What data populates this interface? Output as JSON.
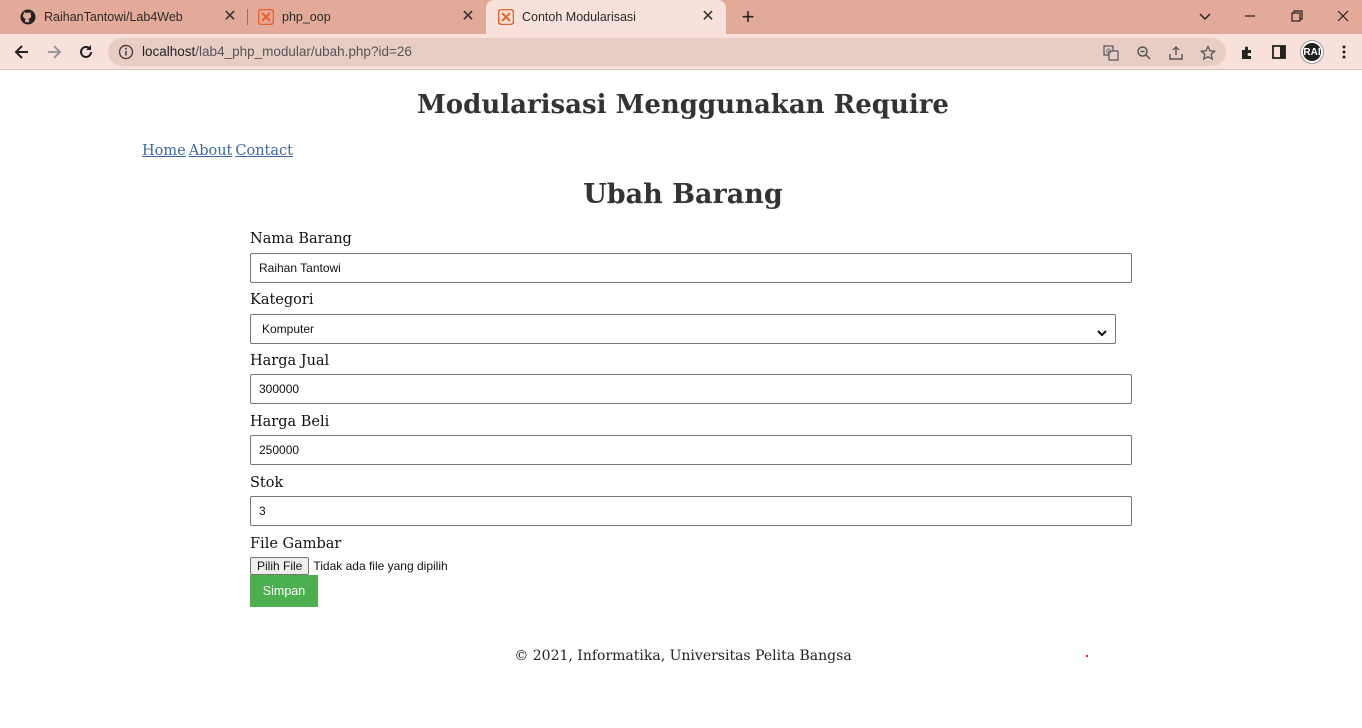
{
  "browser": {
    "tabs": [
      {
        "title": "RaihanTantowi/Lab4Web",
        "icon": "github-icon"
      },
      {
        "title": "php_oop",
        "icon": "xampp-icon"
      },
      {
        "title": "Contoh Modularisasi",
        "icon": "xampp-icon"
      }
    ],
    "url_host": "localhost",
    "url_path": "/lab4_php_modular/ubah.php?id=26",
    "avatar_text": "RAI"
  },
  "page": {
    "header": "Modularisasi Menggunakan Require",
    "nav": [
      "Home",
      "About",
      "Contact"
    ],
    "form_title": "Ubah Barang",
    "fields": {
      "nama_label": "Nama Barang",
      "nama_value": "Raihan Tantowi",
      "kategori_label": "Kategori",
      "kategori_value": "Komputer",
      "harga_jual_label": "Harga Jual",
      "harga_jual_value": "300000",
      "harga_beli_label": "Harga Beli",
      "harga_beli_value": "250000",
      "stok_label": "Stok",
      "stok_value": "3",
      "gambar_label": "File Gambar",
      "file_button": "Pilih File",
      "file_status": "Tidak ada file yang dipilih"
    },
    "submit_label": "Simpan",
    "footer": "© 2021, Informatika, Universitas Pelita Bangsa"
  },
  "colors": {
    "tabbar": "#e3a999",
    "toolbar": "#f8e1da",
    "submit": "#4caf50",
    "link": "#3a6a9b"
  }
}
